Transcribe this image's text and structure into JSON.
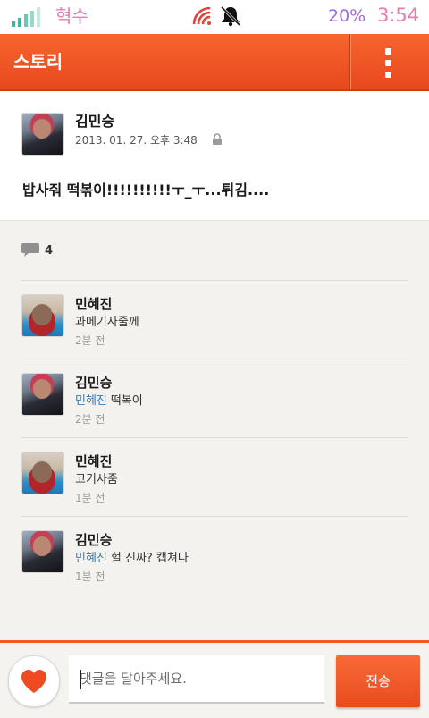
{
  "status_bar": {
    "carrier": "혁수",
    "battery": "20%",
    "time": "3:54",
    "icons": [
      "signal-icon",
      "wifi-alert-icon",
      "bell-muted-icon"
    ]
  },
  "action_bar": {
    "title": "스토리",
    "menu_icon": "overflow-menu-icon",
    "accent": "#f15a2b"
  },
  "post": {
    "author": "김민승",
    "date": "2013. 01. 27. 오후 3:48",
    "privacy_icon": "lock-icon",
    "body": "밥사줘 떡볶이!!!!!!!!!!ㅜ_ㅜ...튀김...."
  },
  "comment_count": "4",
  "comments": [
    {
      "author": "민혜진",
      "mention": "",
      "text": "과메기사줄께",
      "time": "2분 전"
    },
    {
      "author": "김민승",
      "mention": "민혜진",
      "text": "떡복이",
      "time": "2분 전"
    },
    {
      "author": "민혜진",
      "mention": "",
      "text": "고기사줌",
      "time": "1분 전"
    },
    {
      "author": "김민승",
      "mention": "민혜진",
      "text": "헐 진짜? 캡쳐다",
      "time": "1분 전"
    }
  ],
  "composer": {
    "like_icon": "heart-icon",
    "placeholder": "댓글을 달아주세요.",
    "send_label": "전송"
  }
}
